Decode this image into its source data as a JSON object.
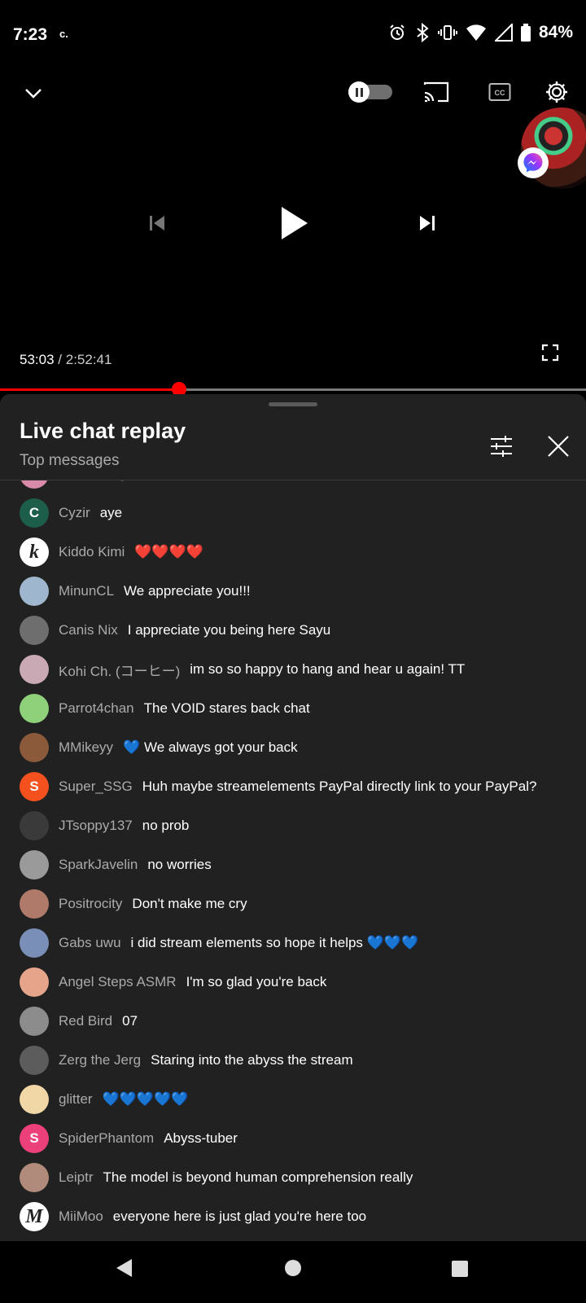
{
  "status_bar": {
    "time": "7:23",
    "small_icon": "c.",
    "battery": "84%",
    "icons": [
      "alarm-icon",
      "bluetooth-icon",
      "vibrate-icon",
      "wifi-icon",
      "signal-icon",
      "battery-icon"
    ]
  },
  "player": {
    "current_time": "53:03",
    "separator": "/ ",
    "duration": "2:52:41",
    "progress": 0.305,
    "accent_color": "#ff0000"
  },
  "chat": {
    "title": "Live chat replay",
    "subtitle": "Top messages",
    "messages": [
      {
        "author": "The Smiley",
        "text": "💙💙💙",
        "avatar_color": "#d98aa8",
        "initial": ""
      },
      {
        "author": "Cyzir",
        "text": "aye",
        "avatar_color": "#1d5e4a",
        "initial": "C"
      },
      {
        "author": "Kiddo Kimi",
        "text": "❤️❤️❤️❤️",
        "avatar_color": "#ffffff",
        "initial": "k"
      },
      {
        "author": "MinunCL",
        "text": "We appreciate you!!!",
        "avatar_color": "#9fb6cf",
        "initial": ""
      },
      {
        "author": "Canis Nix",
        "text": "I appreciate you being here Sayu",
        "avatar_color": "#6e6e6e",
        "initial": ""
      },
      {
        "author": "Kohi Ch. (コーヒー)",
        "text": "im so so happy to hang and hear u again! TT",
        "avatar_color": "#c9a9b4",
        "initial": ""
      },
      {
        "author": "Parrot4chan",
        "text": "The VOID stares back chat",
        "avatar_color": "#8ed17a",
        "initial": ""
      },
      {
        "author": "MMikeyy",
        "text": "💙 We always got your back",
        "avatar_color": "#8a5a3a",
        "initial": ""
      },
      {
        "author": "Super_SSG",
        "text": "Huh maybe streamelements PayPal directly link to your PayPal?",
        "avatar_color": "#f4511e",
        "initial": "S"
      },
      {
        "author": "JTsoppy137",
        "text": "no prob",
        "avatar_color": "#3a3a3a",
        "initial": ""
      },
      {
        "author": "SparkJavelin",
        "text": "no worries",
        "avatar_color": "#9a9a9a",
        "initial": ""
      },
      {
        "author": "Positrocity",
        "text": "Don't make me cry",
        "avatar_color": "#b07a6a",
        "initial": ""
      },
      {
        "author": "Gabs uwu",
        "text": "i did stream elements so hope it helps 💙💙💙",
        "avatar_color": "#7a8fb8",
        "initial": ""
      },
      {
        "author": "Angel Steps ASMR",
        "text": "I'm so glad you're back",
        "avatar_color": "#e6a58a",
        "initial": ""
      },
      {
        "author": "Red Bird",
        "text": "07",
        "avatar_color": "#8c8c8c",
        "initial": ""
      },
      {
        "author": "Zerg the Jerg",
        "text": "Staring into the abyss the stream",
        "avatar_color": "#5c5c5c",
        "initial": ""
      },
      {
        "author": "glitter",
        "text": "💙💙💙💙💙",
        "avatar_color": "#f1d6a6",
        "initial": ""
      },
      {
        "author": "SpiderPhantom",
        "text": "Abyss-tuber",
        "avatar_color": "#ec407a",
        "initial": "S"
      },
      {
        "author": "Leiptr",
        "text": "The model is beyond human comprehension really",
        "avatar_color": "#b08a7a",
        "initial": ""
      },
      {
        "author": "MiiMoo",
        "text": "everyone here is just glad you're here too",
        "avatar_color": "#ffffff",
        "initial": "M"
      }
    ]
  }
}
